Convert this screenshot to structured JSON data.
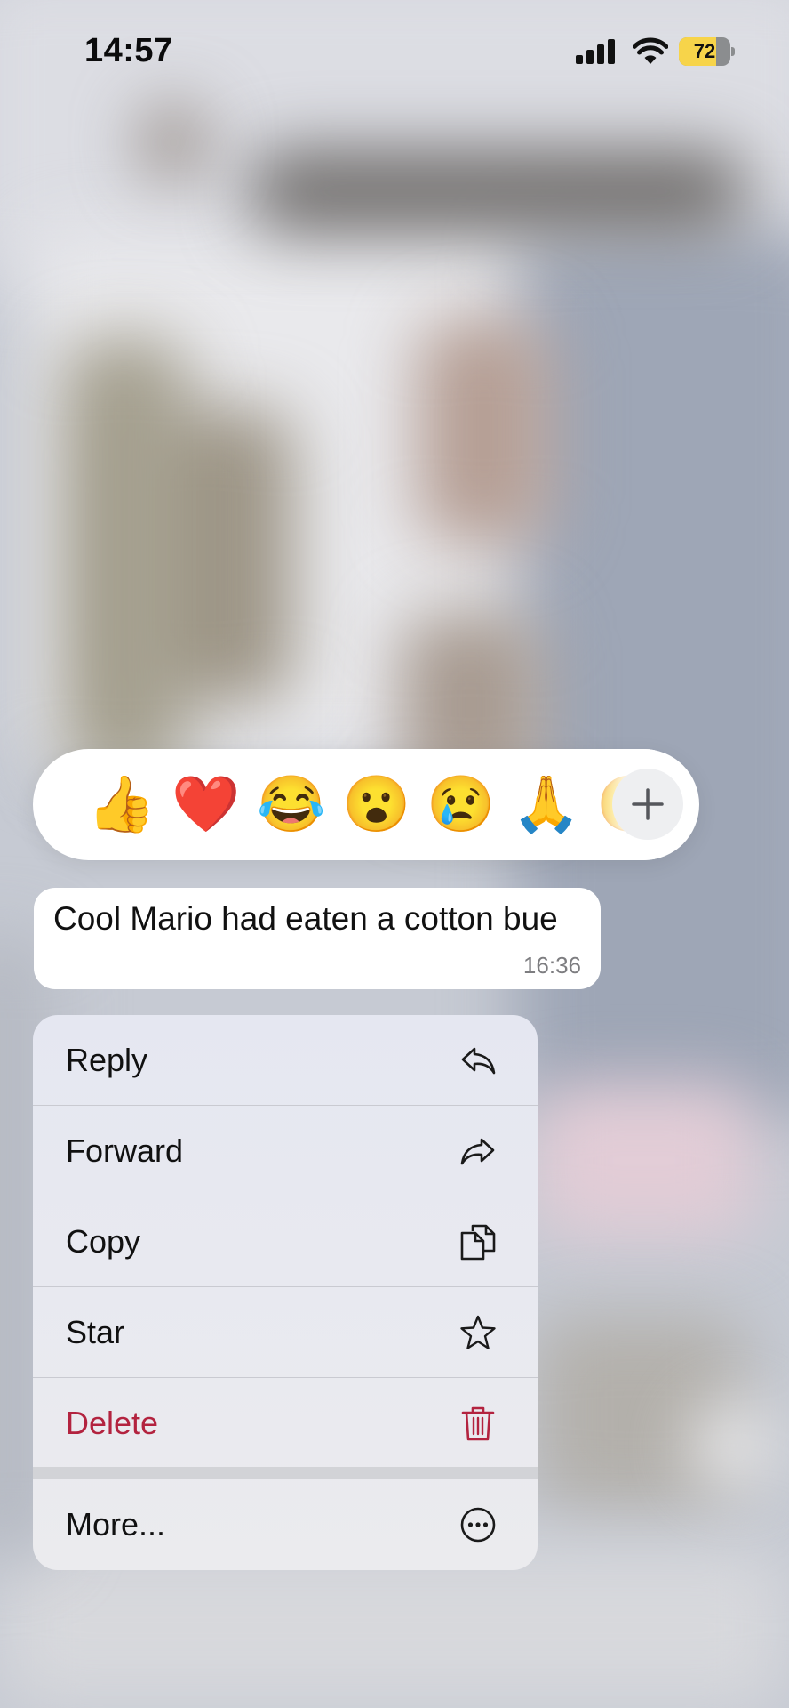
{
  "status_bar": {
    "time": "14:57",
    "battery_level": "72",
    "battery_fraction": 0.72,
    "icons": [
      "signal-icon",
      "wifi-icon",
      "battery-icon"
    ]
  },
  "reactions": {
    "emojis": [
      "👍",
      "❤️",
      "😂",
      "😮",
      "😢",
      "🙏",
      "😑"
    ],
    "more_icon": "plus-icon"
  },
  "message": {
    "text": "Cool Mario had eaten a cotton bue",
    "time": "16:36"
  },
  "context_menu": {
    "items": [
      {
        "label": "Reply",
        "icon": "reply-icon"
      },
      {
        "label": "Forward",
        "icon": "forward-icon"
      },
      {
        "label": "Copy",
        "icon": "copy-icon"
      },
      {
        "label": "Star",
        "icon": "star-icon"
      },
      {
        "label": "Delete",
        "icon": "trash-icon"
      },
      {
        "label": "More...",
        "icon": "more-icon"
      }
    ],
    "colors": {
      "delete": "#b3233f",
      "text": "#111111"
    }
  },
  "colors": {
    "battery_fill": "#f7d44a"
  }
}
